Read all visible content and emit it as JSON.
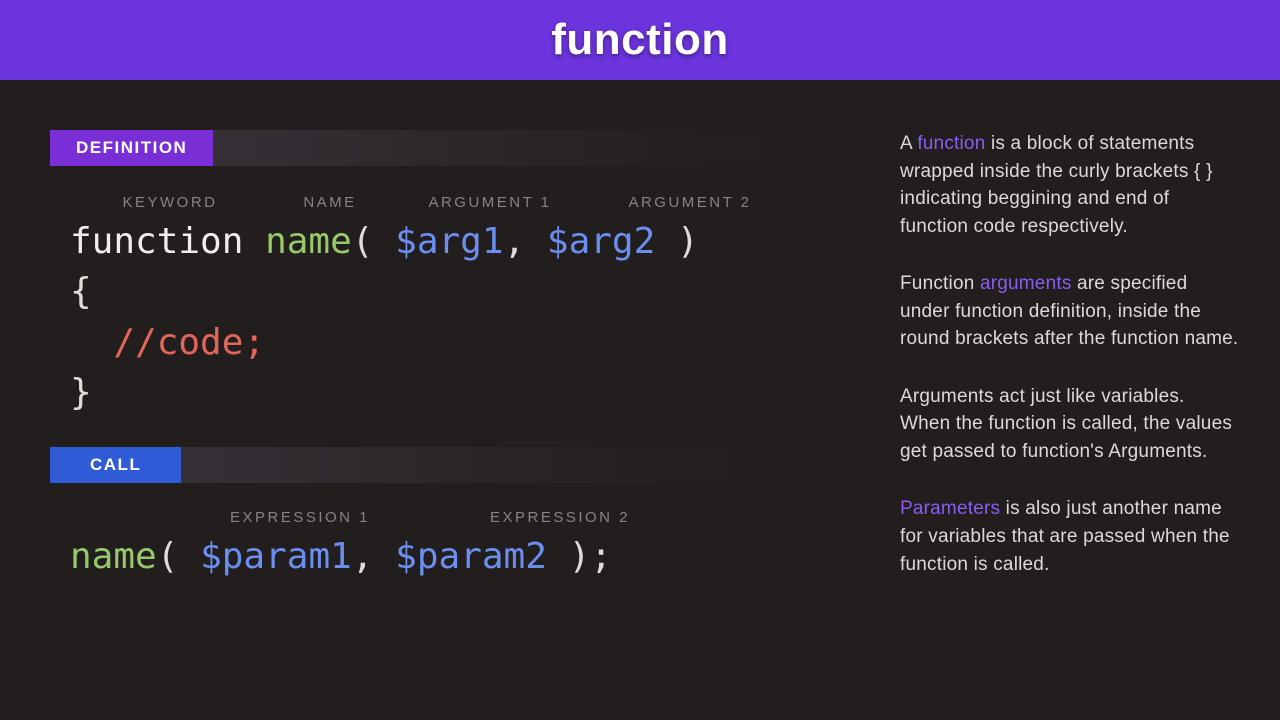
{
  "header": {
    "title": "function"
  },
  "left": {
    "def_tag": "DEFINITION",
    "call_tag": "CALL",
    "annotations": {
      "keyword": "KEYWORD",
      "name": "NAME",
      "arg1": "ARGUMENT 1",
      "arg2": "ARGUMENT 2",
      "expr1": "EXPRESSION 1",
      "expr2": "EXPRESSION 2"
    },
    "def_code": {
      "fn": "function",
      "name": "name",
      "open": "(",
      "arg1": "$arg1",
      "comma": ",",
      "arg2": "$arg2",
      "close": ")",
      "lbrace": "{",
      "comment": "//code;",
      "rbrace": "}"
    },
    "call_code": {
      "name": "name",
      "open": "(",
      "p1": "$param1",
      "comma": ",",
      "p2": "$param2",
      "close": ");"
    }
  },
  "right": {
    "p1a": "A ",
    "p1_hl": "function",
    "p1b": " is a block of statements wrapped inside the curly brackets {  } indicating beggining and end of function code respectively.",
    "p2a": "Function ",
    "p2_hl": "arguments",
    "p2b": " are specified under function definition, inside the round brackets after the function name.",
    "p3": "Arguments act just like variables. When the function is called, the values get passed to function's Arguments.",
    "p4_hl": "Parameters",
    "p4b": " is also just another name for variables that are passed when the function is called."
  }
}
